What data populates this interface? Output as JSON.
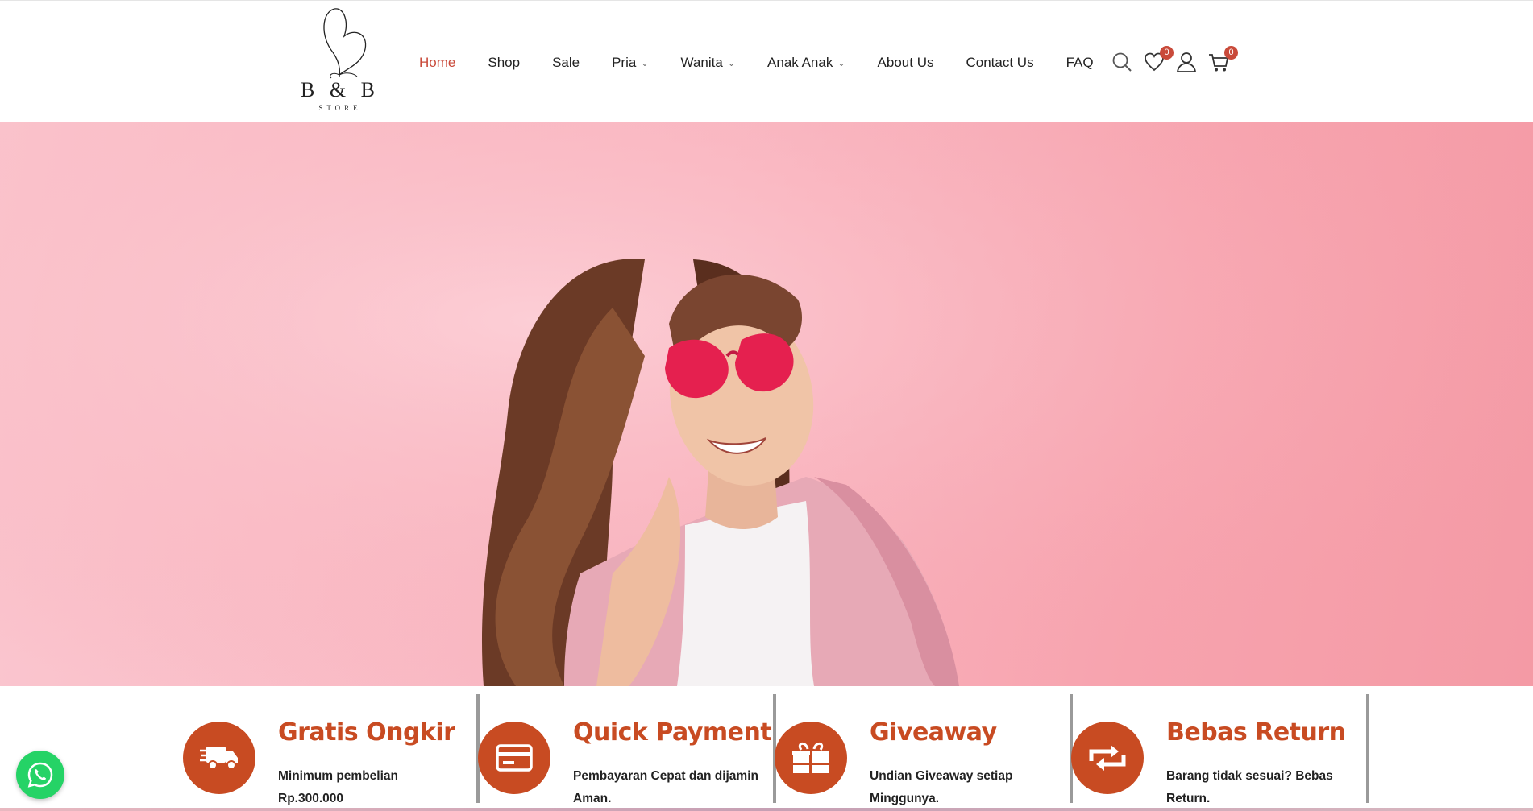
{
  "logo": {
    "brand": "B & B",
    "sub": "STORE"
  },
  "nav": {
    "items": [
      {
        "label": "Home",
        "active": true,
        "dropdown": false
      },
      {
        "label": "Shop",
        "dropdown": false
      },
      {
        "label": "Sale",
        "dropdown": false
      },
      {
        "label": "Pria",
        "dropdown": true
      },
      {
        "label": "Wanita",
        "dropdown": true
      },
      {
        "label": "Anak Anak",
        "dropdown": true
      },
      {
        "label": "About Us",
        "dropdown": false
      },
      {
        "label": "Contact Us",
        "dropdown": false
      },
      {
        "label": "FAQ",
        "dropdown": false
      }
    ]
  },
  "icons": {
    "search": "search-icon",
    "wishlist": "heart-icon",
    "wishlist_count": "0",
    "account": "user-icon",
    "cart": "cart-icon",
    "cart_count": "0"
  },
  "hero": {
    "image": "woman-pink-sunglasses-photo"
  },
  "features": [
    {
      "icon": "delivery-truck-icon",
      "title": "Gratis Ongkir",
      "desc": "Minimum pembelian Rp.300.000"
    },
    {
      "icon": "credit-card-icon",
      "title": "Quick Payment",
      "desc": "Pembayaran Cepat dan dijamin Aman."
    },
    {
      "icon": "gift-icon",
      "title": "Giveaway",
      "desc": "Undian Giveaway setiap Minggunya."
    },
    {
      "icon": "return-arrows-icon",
      "title": "Bebas Return",
      "desc": "Barang tidak sesuai? Bebas Return."
    }
  ],
  "colors": {
    "accent": "#c84b22",
    "nav_active": "#c94a3a",
    "hero_bg": "#f9b6c1",
    "whatsapp": "#25d366"
  }
}
